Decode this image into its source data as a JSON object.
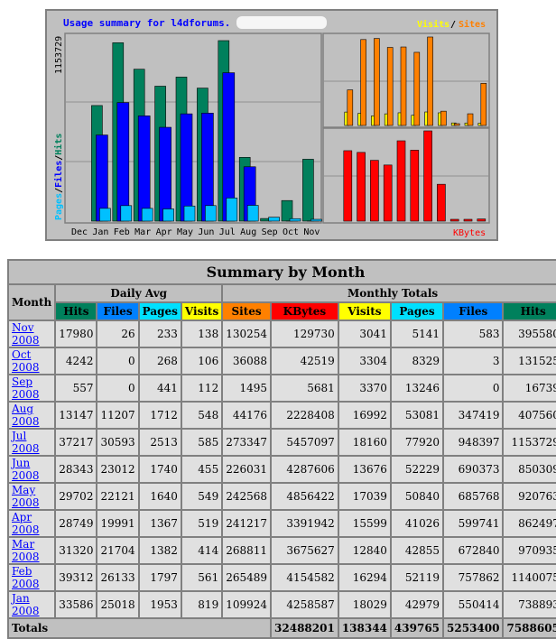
{
  "graph": {
    "title": "Usage summary for l4dforums.",
    "legend_visits": "Visits",
    "legend_slash": "/",
    "legend_sites": "Sites",
    "left_max": "1153729",
    "left_axis_pages": "Pages",
    "left_axis_files": "Files",
    "left_axis_hits": "Hits",
    "right_top_max": "273347",
    "right_bottom_max": "5457097",
    "kbytes_label": "KBytes",
    "colors": {
      "hits": "#00805c",
      "files": "#0000ff",
      "pages": "#00c0ff",
      "visits": "#ffff00",
      "sites": "#ff8000",
      "kbytes": "#ff0000",
      "bg": "#c0c0c0",
      "plot": "#c0c0c0"
    }
  },
  "chart_data": {
    "type": "bar",
    "categories": [
      "Dec",
      "Jan",
      "Feb",
      "Mar",
      "Apr",
      "May",
      "Jun",
      "Jul",
      "Aug",
      "Sep",
      "Oct",
      "Nov"
    ],
    "series": [
      {
        "name": "Hits",
        "values": [
          0,
          738893,
          1140075,
          970935,
          862497,
          920763,
          850309,
          1153729,
          407560,
          16739,
          131525,
          395580
        ]
      },
      {
        "name": "Files",
        "values": [
          0,
          550414,
          757862,
          672840,
          599741,
          685768,
          690373,
          948397,
          347419,
          0,
          3,
          583
        ]
      },
      {
        "name": "Pages",
        "values": [
          0,
          42979,
          52119,
          42855,
          41026,
          50840,
          52229,
          77920,
          53081,
          13246,
          8329,
          5141
        ]
      },
      {
        "name": "Visits",
        "values": [
          0,
          18029,
          16294,
          12840,
          15599,
          17039,
          13676,
          18160,
          16992,
          3370,
          3304,
          3041
        ]
      },
      {
        "name": "Sites",
        "values": [
          0,
          109924,
          265489,
          268811,
          241217,
          242568,
          226031,
          273347,
          44176,
          1495,
          36088,
          130254
        ]
      },
      {
        "name": "KBytes",
        "values": [
          0,
          4258587,
          4154582,
          3675627,
          3391942,
          4856422,
          4287606,
          5457097,
          2228408,
          5681,
          42519,
          129730
        ]
      }
    ]
  },
  "table": {
    "title": "Summary by Month",
    "month_header": "Month",
    "daily_avg": "Daily Avg",
    "monthly_totals": "Monthly Totals",
    "cols": [
      "Hits",
      "Files",
      "Pages",
      "Visits",
      "Sites",
      "KBytes",
      "Visits",
      "Pages",
      "Files",
      "Hits"
    ],
    "rows": [
      [
        "Nov 2008",
        "17980",
        "26",
        "233",
        "138",
        "130254",
        "129730",
        "3041",
        "5141",
        "583",
        "395580"
      ],
      [
        "Oct 2008",
        "4242",
        "0",
        "268",
        "106",
        "36088",
        "42519",
        "3304",
        "8329",
        "3",
        "131525"
      ],
      [
        "Sep 2008",
        "557",
        "0",
        "441",
        "112",
        "1495",
        "5681",
        "3370",
        "13246",
        "0",
        "16739"
      ],
      [
        "Aug 2008",
        "13147",
        "11207",
        "1712",
        "548",
        "44176",
        "2228408",
        "16992",
        "53081",
        "347419",
        "407560"
      ],
      [
        "Jul 2008",
        "37217",
        "30593",
        "2513",
        "585",
        "273347",
        "5457097",
        "18160",
        "77920",
        "948397",
        "1153729"
      ],
      [
        "Jun 2008",
        "28343",
        "23012",
        "1740",
        "455",
        "226031",
        "4287606",
        "13676",
        "52229",
        "690373",
        "850309"
      ],
      [
        "May 2008",
        "29702",
        "22121",
        "1640",
        "549",
        "242568",
        "4856422",
        "17039",
        "50840",
        "685768",
        "920763"
      ],
      [
        "Apr 2008",
        "28749",
        "19991",
        "1367",
        "519",
        "241217",
        "3391942",
        "15599",
        "41026",
        "599741",
        "862497"
      ],
      [
        "Mar 2008",
        "31320",
        "21704",
        "1382",
        "414",
        "268811",
        "3675627",
        "12840",
        "42855",
        "672840",
        "970935"
      ],
      [
        "Feb 2008",
        "39312",
        "26133",
        "1797",
        "561",
        "265489",
        "4154582",
        "16294",
        "52119",
        "757862",
        "1140075"
      ],
      [
        "Jan 2008",
        "33586",
        "25018",
        "1953",
        "819",
        "109924",
        "4258587",
        "18029",
        "42979",
        "550414",
        "738893"
      ]
    ],
    "totals": [
      "Totals",
      "",
      "",
      "",
      "",
      "",
      "32488201",
      "138344",
      "439765",
      "5253400",
      "7588605"
    ]
  }
}
